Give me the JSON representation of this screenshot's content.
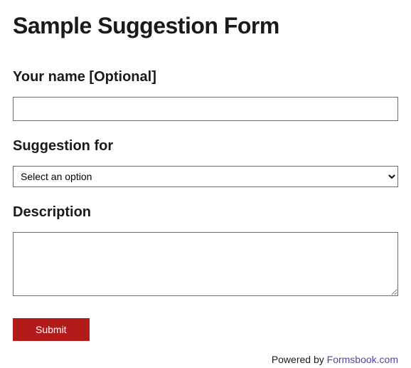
{
  "form": {
    "title": "Sample Suggestion Form",
    "fields": {
      "name": {
        "label": "Your name [Optional]",
        "value": ""
      },
      "suggestion_for": {
        "label": "Suggestion for",
        "selected": "Select an option"
      },
      "description": {
        "label": "Description",
        "value": ""
      }
    },
    "submit_label": "Submit"
  },
  "credit": {
    "prefix": "Powered by ",
    "link_text": "Formsbook.com"
  }
}
